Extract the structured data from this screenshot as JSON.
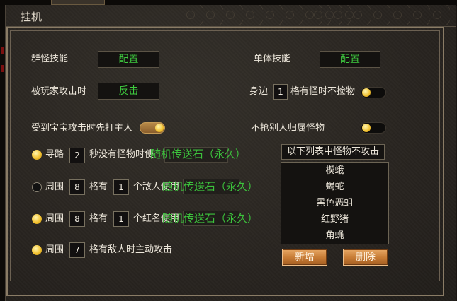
{
  "window": {
    "title": "挂机",
    "top_tab_label": ""
  },
  "skills": {
    "group_label": "群怪技能",
    "group_button": "配置",
    "single_label": "单体技能",
    "single_button": "配置"
  },
  "attacked_by_player": {
    "label": "被玩家攻击时",
    "action": "反击"
  },
  "nearby_pickup": {
    "prefix": "身边",
    "value": "1",
    "suffix": "格有怪时不捡物",
    "toggle_on": false
  },
  "pet_attacked": {
    "label": "受到宝宝攻击时先打主人",
    "toggle_on": true
  },
  "no_steal": {
    "label": "不抢别人归属怪物",
    "toggle_on": false
  },
  "rows": [
    {
      "radio_on": true,
      "prefix": "寻路",
      "value": "2",
      "text": "秒没有怪物时使",
      "item": "随机传送石（永久）"
    },
    {
      "radio_on": false,
      "prefix": "周围",
      "value": "8",
      "text": "格有",
      "value2": "1",
      "text2": "个敌人使用",
      "item": "随机传送石（永久）"
    },
    {
      "radio_on": true,
      "prefix": "周围",
      "value": "8",
      "text": "格有",
      "value2": "1",
      "text2": "个红名使用",
      "item": "随机传送石（永久）"
    },
    {
      "radio_on": true,
      "prefix": "周围",
      "value": "7",
      "text": "格有敌人时主动攻击"
    }
  ],
  "monster_list": {
    "header": "以下列表中怪物不攻击",
    "items": [
      "楔蛾",
      "蝎蛇",
      "黑色恶蛆",
      "红野猪",
      "角蝇"
    ]
  },
  "buttons": {
    "add": "新增",
    "delete": "删除"
  },
  "colors": {
    "accent_green": "#3cc23c",
    "knob_gold": "#f0c030",
    "button_orange": "#c57a34"
  }
}
